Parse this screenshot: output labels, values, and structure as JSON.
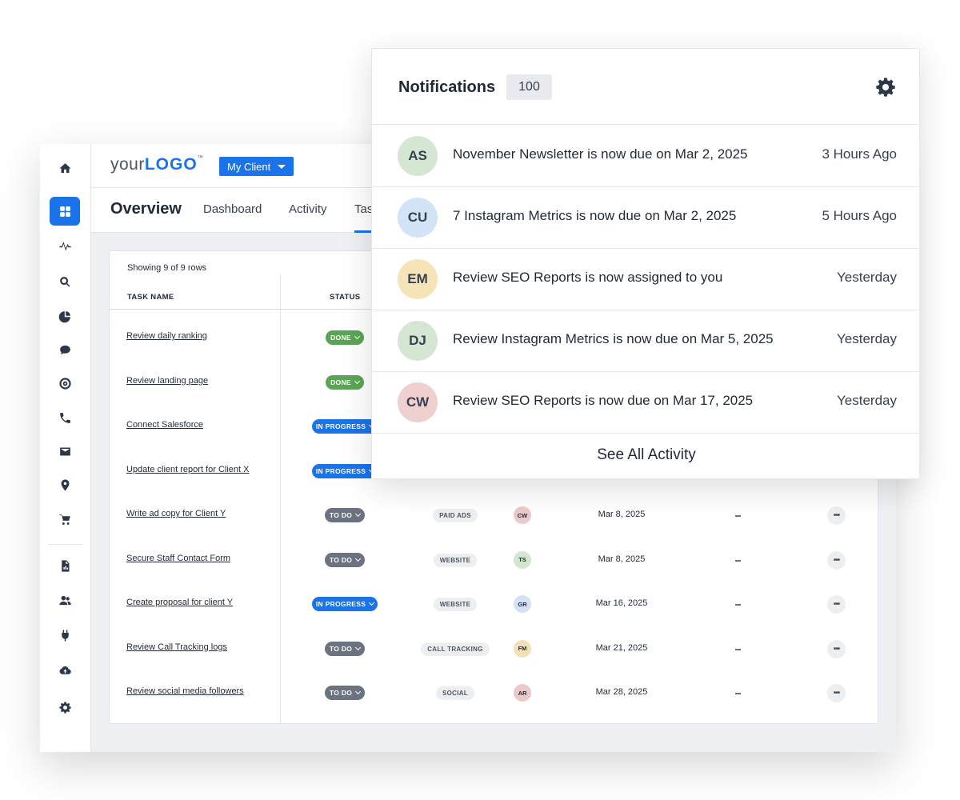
{
  "app": {
    "logo": {
      "part1": "your",
      "part2": "LOGO",
      "tm": "™"
    },
    "client_selector": "My Client",
    "page_title": "Overview",
    "tabs": [
      "Dashboard",
      "Activity",
      "Tas"
    ]
  },
  "sidebar_icons": [
    "home-icon",
    "dashboard-grid-icon",
    "pulse-icon",
    "search-icon",
    "pie-chart-icon",
    "chat-icon",
    "target-icon",
    "phone-icon",
    "mail-icon",
    "location-pin-icon",
    "cart-icon",
    "report-file-icon",
    "users-icon",
    "plug-icon",
    "cloud-icon",
    "settings-icon"
  ],
  "table": {
    "showing": "Showing 9 of 9 rows",
    "headers": {
      "task_name": "TASK NAME",
      "status": "STATUS"
    },
    "rows": [
      {
        "task": "Review daily ranking",
        "status": "DONE",
        "status_type": "done",
        "tag": "",
        "assignee": "",
        "assignee_color": "",
        "date": ""
      },
      {
        "task": "Review landing page",
        "status": "DONE",
        "status_type": "done",
        "tag": "",
        "assignee": "",
        "assignee_color": "",
        "date": ""
      },
      {
        "task": "Connect Salesforce",
        "status": "IN PROGRESS",
        "status_type": "prog",
        "tag": "",
        "assignee": "",
        "assignee_color": "",
        "date": ""
      },
      {
        "task": "Update client report for Client X",
        "status": "IN PROGRESS",
        "status_type": "prog",
        "tag": "",
        "assignee": "",
        "assignee_color": "",
        "date": ""
      },
      {
        "task": "Write ad copy for Client Y",
        "status": "TO DO",
        "status_type": "todo",
        "tag": "PAID ADS",
        "assignee": "CW",
        "assignee_color": "#ecc9c9",
        "date": "Mar 8, 2025"
      },
      {
        "task": "Secure Staff Contact Form",
        "status": "TO DO",
        "status_type": "todo",
        "tag": "WEBSITE",
        "assignee": "TS",
        "assignee_color": "#d3e6d0",
        "date": "Mar 8, 2025"
      },
      {
        "task": "Create proposal for client Y",
        "status": "IN PROGRESS",
        "status_type": "prog",
        "tag": "WEBSITE",
        "assignee": "GR",
        "assignee_color": "#d3e2f6",
        "date": "Mar 16, 2025"
      },
      {
        "task": "Review Call Tracking logs",
        "status": "TO DO",
        "status_type": "todo",
        "tag": "CALL TRACKING",
        "assignee": "FM",
        "assignee_color": "#f3e1b6",
        "date": "Mar 21, 2025"
      },
      {
        "task": "Review social media followers",
        "status": "TO DO",
        "status_type": "todo",
        "tag": "SOCIAL",
        "assignee": "AR",
        "assignee_color": "#ecc9c9",
        "date": "Mar 28, 2025"
      }
    ]
  },
  "notifications": {
    "title": "Notifications",
    "count": "100",
    "items": [
      {
        "initials": "AS",
        "color": "#d5e6d3",
        "text": "November Newsletter is now due on Mar 2, 2025",
        "time": "3 Hours Ago"
      },
      {
        "initials": "CU",
        "color": "#d4e4f8",
        "text": "7 Instagram Metrics is now due on Mar 2, 2025",
        "time": "5 Hours Ago"
      },
      {
        "initials": "EM",
        "color": "#f6e4b9",
        "text": "Review SEO Reports is now assigned to you",
        "time": "Yesterday"
      },
      {
        "initials": "DJ",
        "color": "#d5e6d3",
        "text": "Review Instagram Metrics is now due on Mar 5, 2025",
        "time": "Yesterday"
      },
      {
        "initials": "CW",
        "color": "#efcfcf",
        "text": "Review SEO Reports is now due on Mar 17, 2025",
        "time": "Yesterday"
      }
    ],
    "see_all": "See All Activity"
  },
  "colors": {
    "accent": "#1a73e8",
    "done": "#5aa555",
    "todo": "#6b7280"
  }
}
